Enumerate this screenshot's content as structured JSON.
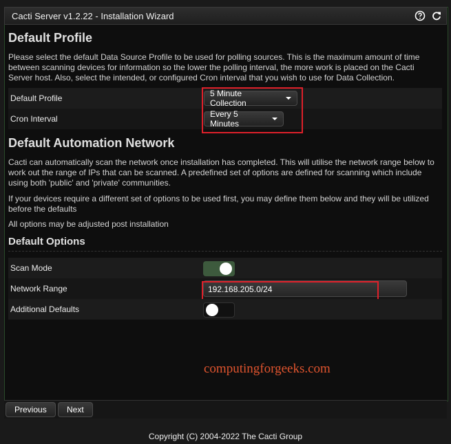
{
  "window": {
    "title": "Cacti Server v1.2.22 - Installation Wizard",
    "icons": [
      "help-icon",
      "refresh-icon"
    ]
  },
  "default_profile": {
    "heading": "Default Profile",
    "description": "Please select the default Data Source Profile to be used for polling sources. This is the maximum amount of time between scanning devices for information so the lower the polling interval, the more work is placed on the Cacti Server host. Also, select the intended, or configured Cron interval that you wish to use for Data Collection.",
    "fields": [
      {
        "label": "Default Profile",
        "value": "5 Minute Collection"
      },
      {
        "label": "Cron Interval",
        "value": "Every 5 Minutes"
      }
    ]
  },
  "automation": {
    "heading": "Default Automation Network",
    "para1": "Cacti can automatically scan the network once installation has completed. This will utilise the network range below to work out the range of IPs that can be scanned. A predefined set of options are defined for scanning which include using both 'public' and 'private' communities.",
    "para2": "If your devices require a different set of options to be used first, you may define them below and they will be utilized before the defaults",
    "para3": "All options may be adjusted post installation"
  },
  "options": {
    "heading": "Default Options",
    "scan_mode": {
      "label": "Scan Mode",
      "state": "on"
    },
    "network_range": {
      "label": "Network Range",
      "value": "192.168.205.0/24"
    },
    "additional_defaults": {
      "label": "Additional Defaults",
      "state": "off"
    }
  },
  "watermark": "computingforgeeks.com",
  "buttons": {
    "previous": "Previous",
    "next": "Next"
  },
  "copyright": "Copyright (C) 2004-2022 The Cacti Group",
  "colors": {
    "highlight": "#e0202a",
    "toggle_on": "#3d5a3d",
    "watermark": "#e0542e"
  }
}
